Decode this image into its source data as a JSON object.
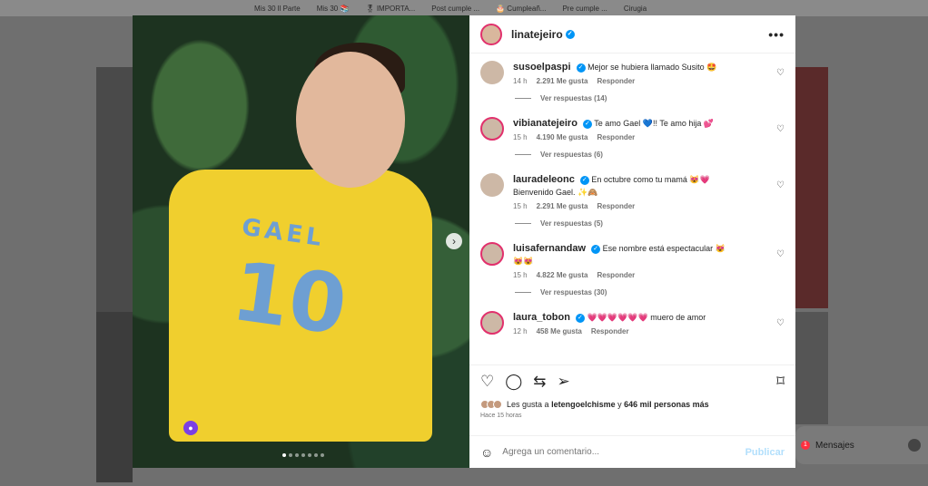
{
  "bookmarks": [
    "Mis 30 ll Parte",
    "Mis 30 📚",
    "🎖 IMPORTA...",
    "Post cumple ...",
    "🎂 Cumpleañ...",
    "Pre cumple ...",
    "Cirugia"
  ],
  "post": {
    "author": "linatejeiro",
    "more_label": "•••",
    "jersey_name": "GAEL",
    "jersey_number": "10",
    "next_label": "›",
    "carousel_count": 7,
    "carousel_active": 0
  },
  "comments": [
    {
      "user": "susoelpaspi",
      "text": "Mejor se hubiera llamado Susito 🤩",
      "time": "14 h",
      "likes": "2.291 Me gusta",
      "reply": "Responder",
      "replies": "Ver respuestas (14)"
    },
    {
      "user": "vibianatejeiro",
      "text": "Te amo Gael 💙!! Te amo hija 💕",
      "time": "15 h",
      "likes": "4.190 Me gusta",
      "reply": "Responder",
      "replies": "Ver respuestas (6)"
    },
    {
      "user": "lauradeleonc",
      "text": "En octubre como tu mamá 😻💗 Bienvenido Gael. ✨🙈",
      "time": "15 h",
      "likes": "2.291 Me gusta",
      "reply": "Responder",
      "replies": "Ver respuestas (5)"
    },
    {
      "user": "luisafernandaw",
      "text": "Ese nombre está espectacular 😻😻😻",
      "time": "15 h",
      "likes": "4.822 Me gusta",
      "reply": "Responder",
      "replies": "Ver respuestas (30)"
    },
    {
      "user": "laura_tobon",
      "text": "💗💗💗💗💗💗 muero de amor",
      "time": "12 h",
      "likes": "458 Me gusta",
      "reply": "Responder",
      "replies": ""
    }
  ],
  "likes": {
    "prefix": "Les gusta a",
    "user": "letengoelchisme",
    "connector": "y",
    "others": "646 mil personas más"
  },
  "timestamp": "Hace 15 horas",
  "add_comment": {
    "placeholder": "Agrega un comentario...",
    "post_label": "Publicar"
  },
  "messages": {
    "label": "Mensajes",
    "badge": "1"
  },
  "colors": {
    "accent": "#0095f6",
    "ring": "#e1306c",
    "post_disabled": "#b2dffc"
  }
}
